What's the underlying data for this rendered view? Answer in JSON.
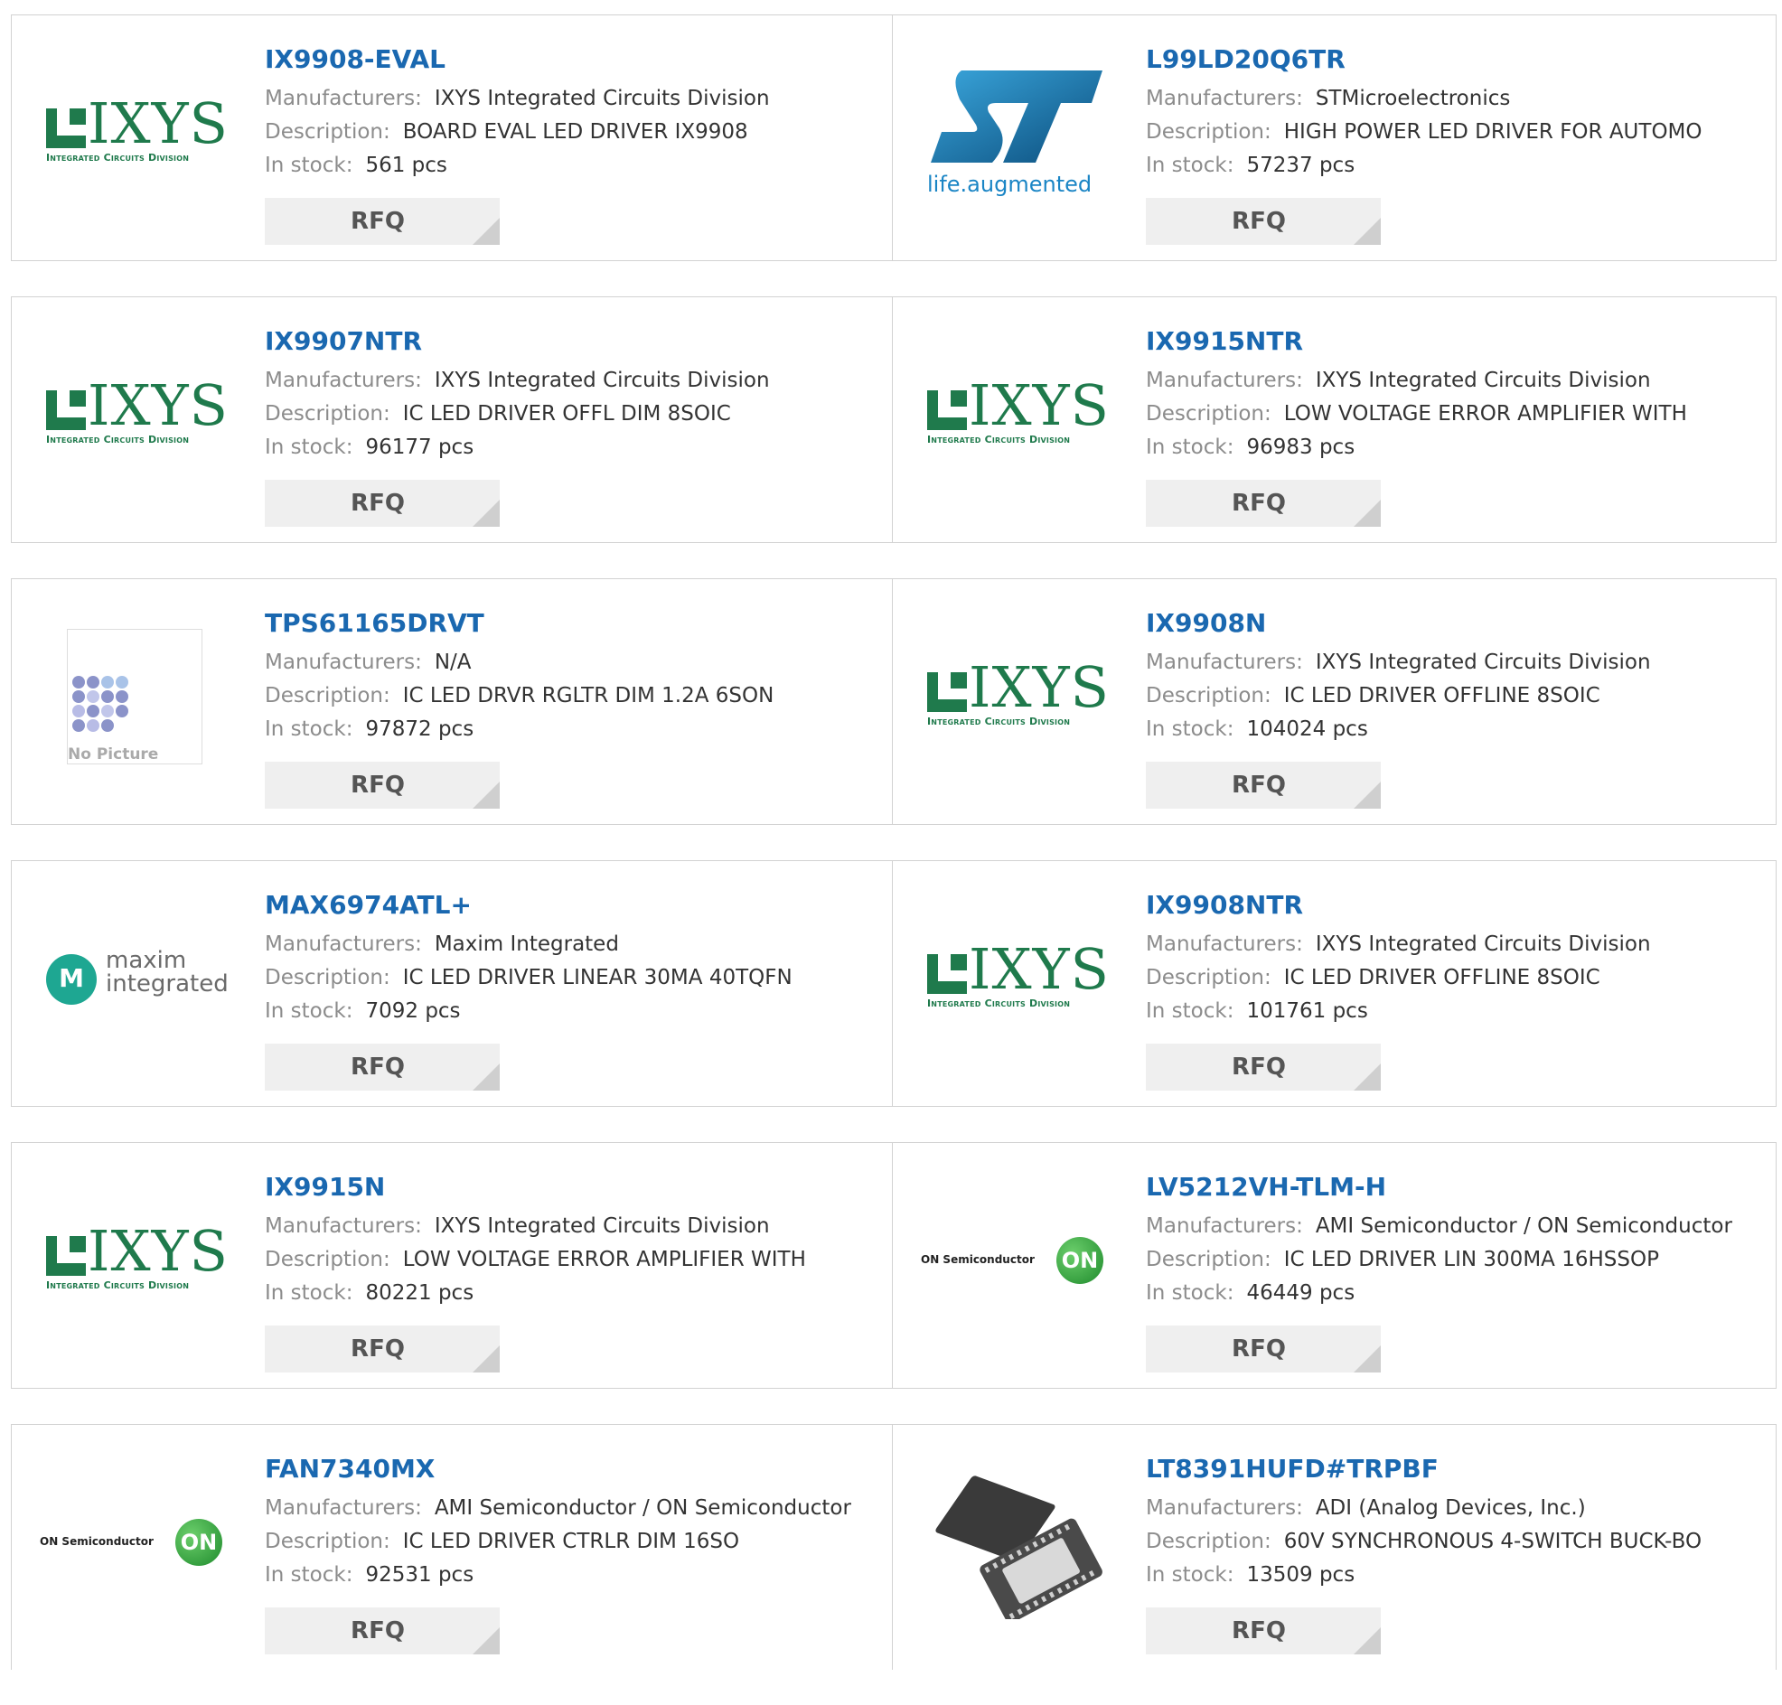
{
  "labels": {
    "manufacturers": "Manufacturers:",
    "description": "Description:",
    "in_stock": "In stock:",
    "rfq": "RFQ"
  },
  "logo_text": {
    "ixys_word": "IXYS",
    "ixys_sub": "Integrated Circuits Division",
    "st_tagline": "life.augmented",
    "no_picture": "No Picture",
    "maxim_line1": "maxim",
    "maxim_line2": "integrated",
    "maxim_mark": "M",
    "on_text": "ON Semiconductor",
    "on_mark": "ON"
  },
  "products": [
    {
      "part": "IX9908-EVAL",
      "manufacturer": "IXYS Integrated Circuits Division",
      "description": "BOARD EVAL LED DRIVER IX9908",
      "stock": "561 pcs",
      "logo": "ixys"
    },
    {
      "part": "L99LD20Q6TR",
      "manufacturer": "STMicroelectronics",
      "description": "HIGH POWER LED DRIVER FOR AUTOMO",
      "stock": "57237 pcs",
      "logo": "st"
    },
    {
      "part": "IX9907NTR",
      "manufacturer": "IXYS Integrated Circuits Division",
      "description": "IC LED DRIVER OFFL DIM 8SOIC",
      "stock": "96177 pcs",
      "logo": "ixys"
    },
    {
      "part": "IX9915NTR",
      "manufacturer": "IXYS Integrated Circuits Division",
      "description": "LOW VOLTAGE ERROR AMPLIFIER WITH",
      "stock": "96983 pcs",
      "logo": "ixys"
    },
    {
      "part": "TPS61165DRVT",
      "manufacturer": "N/A",
      "description": "IC LED DRVR RGLTR DIM 1.2A 6SON",
      "stock": "97872 pcs",
      "logo": "nopic"
    },
    {
      "part": "IX9908N",
      "manufacturer": "IXYS Integrated Circuits Division",
      "description": "IC LED DRIVER OFFLINE 8SOIC",
      "stock": "104024 pcs",
      "logo": "ixys"
    },
    {
      "part": "MAX6974ATL+",
      "manufacturer": "Maxim Integrated",
      "description": "IC LED DRIVER LINEAR 30MA 40TQFN",
      "stock": "7092 pcs",
      "logo": "maxim"
    },
    {
      "part": "IX9908NTR",
      "manufacturer": "IXYS Integrated Circuits Division",
      "description": "IC LED DRIVER OFFLINE 8SOIC",
      "stock": "101761 pcs",
      "logo": "ixys"
    },
    {
      "part": "IX9915N",
      "manufacturer": "IXYS Integrated Circuits Division",
      "description": "LOW VOLTAGE ERROR AMPLIFIER WITH",
      "stock": "80221 pcs",
      "logo": "ixys"
    },
    {
      "part": "LV5212VH-TLM-H",
      "manufacturer": "AMI Semiconductor / ON Semiconductor",
      "description": "IC LED DRIVER LIN 300MA 16HSSOP",
      "stock": "46449 pcs",
      "logo": "on"
    },
    {
      "part": "FAN7340MX",
      "manufacturer": "AMI Semiconductor / ON Semiconductor",
      "description": "IC LED DRIVER CTRLR DIM 16SO",
      "stock": "92531 pcs",
      "logo": "on"
    },
    {
      "part": "LT8391HUFD#TRPBF",
      "manufacturer": "ADI (Analog Devices, Inc.)",
      "description": "60V SYNCHRONOUS 4-SWITCH BUCK-BO",
      "stock": "13509 pcs",
      "logo": "chip"
    }
  ],
  "colors": {
    "part_link": "#1a68b0",
    "ixys_green": "#1f7a4c",
    "st_blue": "#1a85c5",
    "maxim_teal": "#1ea792",
    "on_green": "#2e9a3a"
  }
}
